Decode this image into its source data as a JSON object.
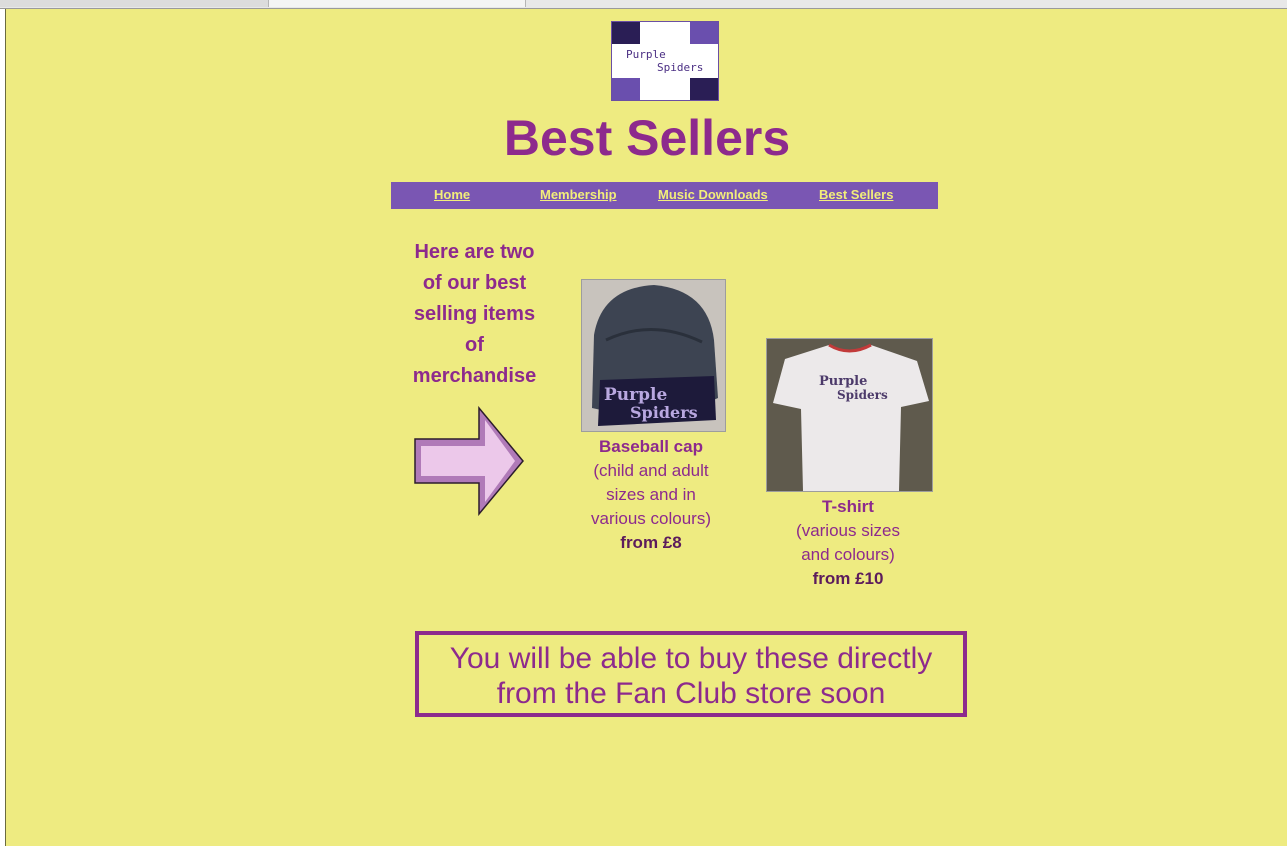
{
  "logo": {
    "line1": "Purple",
    "line2": "Spiders"
  },
  "page_title": "Best Sellers",
  "nav": [
    {
      "label": "Home"
    },
    {
      "label": "Membership"
    },
    {
      "label": "Music Downloads"
    },
    {
      "label": "Best Sellers"
    }
  ],
  "intro": {
    "line1": "Here are two",
    "line2": "of our best",
    "line3": "selling items",
    "line4": "of",
    "line5": "merchandise"
  },
  "products": [
    {
      "name": "Baseball cap",
      "desc1": "(child and adult",
      "desc2": "sizes and in",
      "desc3": "various colours)",
      "price": "from £8",
      "print1": "Purple",
      "print2": "Spiders"
    },
    {
      "name": "T-shirt",
      "desc1": "(various sizes",
      "desc2": "and colours)",
      "price": "from £10",
      "print1": "Purple",
      "print2": "Spiders"
    }
  ],
  "notice": {
    "line1": "You will be able to buy these directly",
    "line2": "from the Fan Club store soon"
  },
  "colors": {
    "background": "#eeeb81",
    "accent": "#8d2a8d",
    "nav_bar": "#7a56b3",
    "nav_link": "#f2ee7a"
  }
}
